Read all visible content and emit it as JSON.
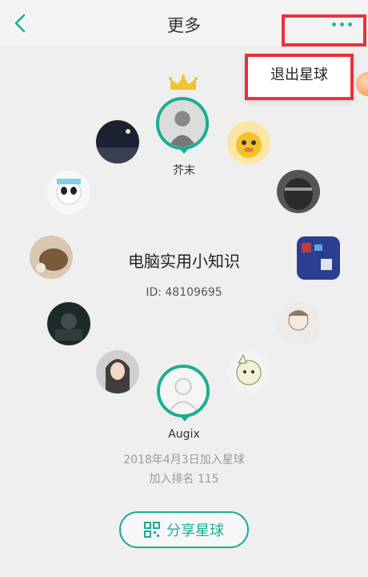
{
  "header": {
    "title": "更多",
    "back_icon": "chevron-left-icon",
    "more_icon": "more-dots-icon"
  },
  "menu": {
    "items": [
      "退出星球"
    ]
  },
  "circle": {
    "owner": {
      "name": "芥末",
      "crown_icon": "crown-icon"
    },
    "group_name": "电脑实用小知识",
    "group_id": "ID: 48109695",
    "me": {
      "name": "Augix"
    },
    "join_date": "2018年4月3日加入星球",
    "join_rank": "加入排名 115"
  },
  "share": {
    "label": "分享星球",
    "icon": "qr-code-icon"
  },
  "colors": {
    "accent": "#1aae93",
    "highlight_border": "#e8333a",
    "crown": "#f1c232"
  }
}
